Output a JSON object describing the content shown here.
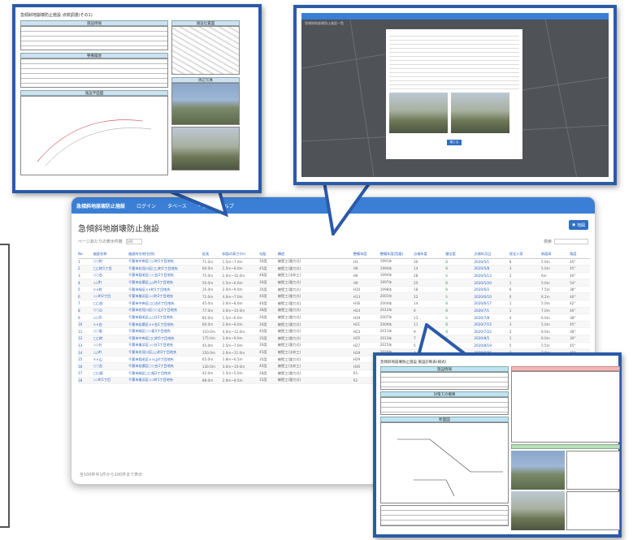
{
  "app": {
    "brand": "急傾斜地崩壊防止施設",
    "nav": [
      "ログイン",
      "タベース",
      "一覧",
      "ヘルプ"
    ],
    "page_title": "急傾斜地崩壊防止施設",
    "map_button": "地図",
    "rows_label": "ページあたりの表示件数",
    "rows_value": "100",
    "search_label": "検索",
    "footer": "全100件中1件から100件まで表示"
  },
  "table": {
    "headers": [
      "No",
      "施設名称",
      "施設所在地(住所)",
      "延長",
      "斜面の高さ(m)",
      "勾配",
      "構造",
      "整備年度",
      "整備年度(西暦)",
      "点検年度",
      "健全度",
      "点検年月日",
      "保全人家",
      "斜面高",
      "角度"
    ],
    "rows": [
      [
        "1",
        "○○町",
        "千葉市中央区○○町1丁目地先",
        "71.0m",
        "1.5m~7.0m",
        "30度",
        "擁壁工(重力式)",
        "H3",
        "1991年",
        "30",
        "B",
        "2020/5/1",
        "8",
        "5.0m",
        "45°"
      ],
      [
        "2",
        "□□町1丁目",
        "千葉市花見川区□□町1丁目地先",
        "60.0m",
        "1.5m~8.0m",
        "45度",
        "擁壁工(重力式)",
        "H6",
        "1994年",
        "14",
        "B",
        "2020/5/8",
        "3",
        "5.0m",
        "45°"
      ],
      [
        "3",
        "○○台",
        "千葉市稲毛区○○台2丁目地先",
        "75.0m",
        "2.0m~10.0m",
        "48度",
        "擁壁工(法枠工)",
        "H6",
        "1994年",
        "28",
        "S",
        "2020/5/13",
        "2",
        "6m",
        "40°"
      ],
      [
        "4",
        "△△町",
        "千葉市若葉区△△町3丁目地先",
        "50.0m",
        "1.5m~6.0m",
        "30度",
        "擁壁工(重力式)",
        "H9",
        "1997年",
        "25",
        "B",
        "2020/5/20",
        "1",
        "5.0m",
        "54°"
      ],
      [
        "5",
        "××町",
        "千葉市緑区××町1丁目地先",
        "35.0m",
        "2.0m~9.0m",
        "35度",
        "擁壁工(重力式)",
        "H10",
        "1998年",
        "18",
        "B",
        "2020/6/2",
        "6",
        "7.5m",
        "38°"
      ],
      [
        "6",
        "◇◇町2丁目",
        "千葉市美浜区◇◇町2丁目地先",
        "72.0m",
        "4.0m~7.0m",
        "40度",
        "擁壁工(重力式)",
        "H13",
        "2001年",
        "22",
        "S",
        "2020/6/10",
        "0",
        "6.2m",
        "40°"
      ],
      [
        "7",
        "□□台",
        "千葉市中央区□□台4丁目地先",
        "45.0m",
        "2.0m~8.0m",
        "40度",
        "擁壁工(重力式)",
        "H16",
        "2004年",
        "14",
        "B",
        "2020/6/17",
        "1",
        "5.0m",
        "42°"
      ],
      [
        "8",
        "○○山",
        "千葉市花見川区○○山1丁目地先",
        "77.0m",
        "3.0m~10.0m",
        "38度",
        "擁壁工(重力式)",
        "H24",
        "2012年",
        "6",
        "B",
        "2020/7/1",
        "1",
        "7.0m",
        "40°"
      ],
      [
        "9",
        "△△谷",
        "千葉市稲毛区△△谷2丁目地先",
        "85.0m",
        "1.5m~6.0m",
        "26度",
        "擁壁工(重力式)",
        "H19",
        "2007年",
        "13",
        "S",
        "2020/7/8",
        "4",
        "6.0m",
        "38°"
      ],
      [
        "10",
        "××台",
        "千葉市若葉区××台1丁目地先",
        "60.0m",
        "2.0m~8.0m",
        "30度",
        "擁壁工(重力式)",
        "H21",
        "2009年",
        "11",
        "B",
        "2020/7/15",
        "3",
        "5.0m",
        "45°"
      ],
      [
        "11",
        "○○坂",
        "千葉市緑区○○坂3丁目地先",
        "110.0m",
        "4.0m~12.0m",
        "40度",
        "擁壁工(重力式)",
        "H23",
        "2011年",
        "9",
        "B",
        "2020/7/22",
        "2",
        "8.0m",
        "38°"
      ],
      [
        "12",
        "□□町",
        "千葉市中央区□□町5丁目地先",
        "175.0m",
        "3.0m~9.0m",
        "35度",
        "擁壁工(重力式)",
        "H25",
        "2013年",
        "7",
        "S",
        "2020/8/5",
        "1",
        "6.0m",
        "30°"
      ],
      [
        "13",
        "◇◇谷",
        "千葉市美浜区◇◇谷1丁目地先",
        "45.0m",
        "2.5m~7.0m",
        "30度",
        "擁壁工(重力式)",
        "H27",
        "2015年",
        "5",
        "B",
        "2020/8/19",
        "5",
        "5.5m",
        "45°"
      ],
      [
        "14",
        "△△町",
        "千葉市花見川区△△町2丁目地先",
        "150.0m",
        "2.0m~11.0m",
        "45度",
        "擁壁工(法枠工)",
        "H28",
        "2016年",
        "4",
        "B",
        "2020/8/26",
        "2",
        "7.0m",
        "42°"
      ],
      [
        "15",
        "××山",
        "千葉市稲毛区××山4丁目地先",
        "65.0m",
        "1.8m~6.5m",
        "35度",
        "擁壁工(重力式)",
        "H29",
        "2017年",
        "3",
        "B",
        "2020/9/2",
        "3",
        "5.2m",
        "40°"
      ],
      [
        "16",
        "○○台",
        "千葉市若葉区○○台1丁目地先",
        "130.0m",
        "3.0m~10.0m",
        "40度",
        "擁壁工(法枠工)",
        "H30",
        "2018年",
        "2",
        "S",
        "2020/9/9",
        "1",
        "6.5m",
        "36°"
      ],
      [
        "17",
        "□□坂",
        "千葉市緑区□□坂2丁目地先",
        "42.0m",
        "1.5m~5.0m",
        "28度",
        "擁壁工(重力式)",
        "R1",
        "2019年",
        "1",
        "B",
        "2020/9/16",
        "0",
        "4.5m",
        "35°"
      ],
      [
        "18",
        "◇◇町1丁目",
        "千葉市美浜区◇◇町1丁目地先",
        "88.0m",
        "2.0m~8.5m",
        "35度",
        "擁壁工(重力式)",
        "R2",
        "2020年",
        "0",
        "B",
        "2020/9/30",
        "2",
        "6.0m",
        "30°"
      ]
    ]
  },
  "callouts": {
    "top_left_title": "急傾斜地崩壊防止施設 点検調書(その1)",
    "top_left_sections": [
      "施設情報",
      "施設位置図",
      "整備履歴",
      "周辺写真",
      "施設平面図"
    ],
    "top_right_title": "急傾斜地崩壊防止施設一覧",
    "top_right_button": "閉じる",
    "bottom_right_title": "急傾斜地崩壊防止施設 施設診断表(様式)",
    "bottom_right_sections": [
      "施設情報",
      "対策工の概要",
      "断面図",
      "写真"
    ]
  },
  "colors": {
    "nav": "#3a7fd5",
    "border": "#2b5aa8",
    "link": "#2a62c0",
    "green": "#3aa55a"
  }
}
